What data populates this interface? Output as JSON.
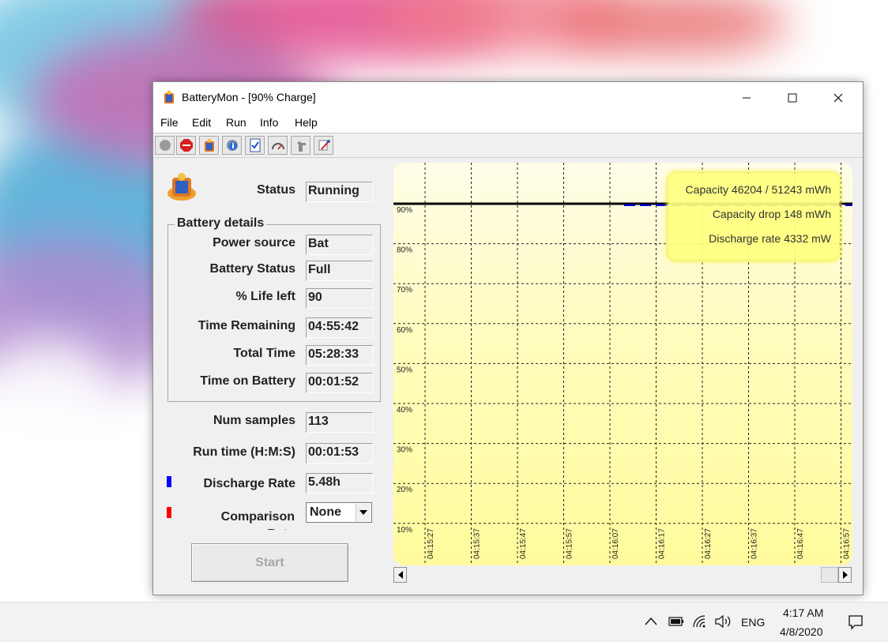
{
  "window": {
    "title": "BatteryMon - [90% Charge]",
    "minimize_glyph": "—",
    "maximize_glyph": "☐",
    "close_glyph": "✕"
  },
  "menu": [
    "File",
    "Edit",
    "Run",
    "Info",
    "Help"
  ],
  "toolbar": [
    "record-icon",
    "stop-icon",
    "battery-icon",
    "settings-info-icon",
    "checklist-icon",
    "gauge-icon",
    "hand-icon",
    "tools-icon"
  ],
  "status": {
    "label": "Status",
    "value": "Running"
  },
  "battery_details": {
    "title": "Battery details",
    "rows": [
      {
        "label": "Power source",
        "value": "Bat"
      },
      {
        "label": "Battery Status",
        "value": "Full"
      },
      {
        "label": "% Life left",
        "value": "90"
      },
      {
        "label": "Time Remaining",
        "value": "04:55:42"
      },
      {
        "label": "Total Time",
        "value": "05:28:33"
      },
      {
        "label": "Time on Battery",
        "value": "00:01:52"
      }
    ]
  },
  "stats": {
    "num_samples": {
      "label": "Num samples",
      "value": "113"
    },
    "run_time": {
      "label": "Run time (H:M:S)",
      "value": "00:01:53"
    },
    "discharge_rate": {
      "label": "Discharge Rate",
      "value": "5.48h",
      "marker_color": "#0000ff"
    },
    "comparison_rate": {
      "label": "Comparison Rate",
      "value": "None",
      "marker_color": "#ff0000"
    }
  },
  "start_button": "Start",
  "chart_data": {
    "type": "line",
    "y_ticks": [
      "90%",
      "80%",
      "70%",
      "60%",
      "50%",
      "40%",
      "30%",
      "20%",
      "10%"
    ],
    "x_ticks": [
      "04:15:27",
      "04:15:37",
      "04:15:47",
      "04:15:57",
      "04:16:07",
      "04:16:17",
      "04:16:27",
      "04:16:37",
      "04:16:47",
      "04:16:57"
    ],
    "ylim": [
      10,
      90
    ],
    "grid": true,
    "series": [
      {
        "color": "#000000",
        "y_start": 90,
        "y_end": 90
      },
      {
        "color": "#0000ff",
        "y_start": 90,
        "y_end": 90,
        "visible_from": "04:16:07"
      }
    ],
    "info_box": {
      "capacity": "Capacity 46204 / 51243 mWh",
      "capacity_drop": "Capacity drop 148 mWh",
      "discharge_rate": "Discharge rate 4332 mW"
    }
  },
  "taskbar": {
    "language": "ENG",
    "time": "4:17 AM",
    "date": "4/8/2020"
  }
}
